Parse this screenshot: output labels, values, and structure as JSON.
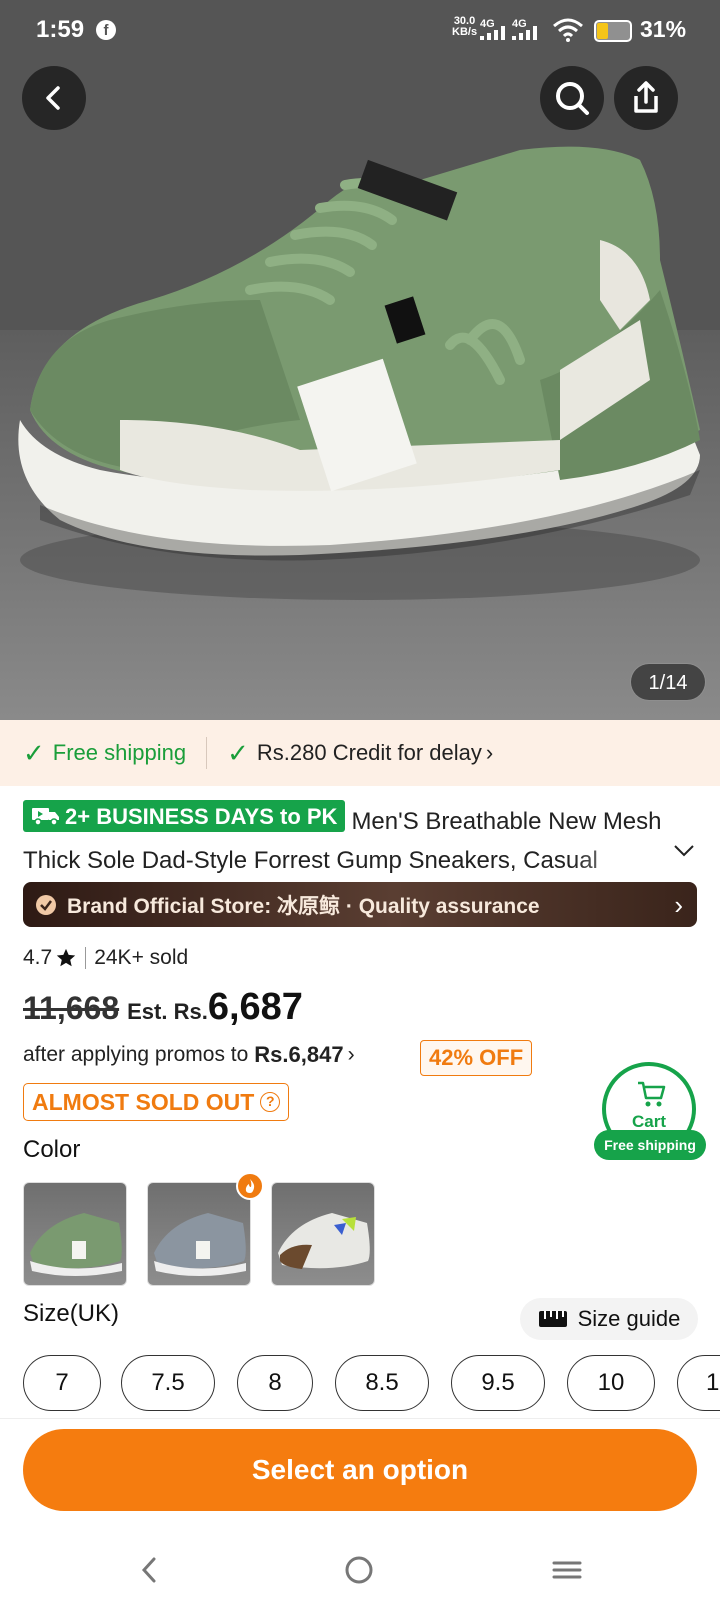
{
  "status_bar": {
    "time": "1:59",
    "network_speed": "30.0",
    "network_unit": "KB/s",
    "signal1": "4G",
    "signal2": "4G",
    "battery": "31%"
  },
  "hero": {
    "image_counter": "1/14",
    "icons": [
      "back-arrow-icon",
      "search-icon",
      "share-icon"
    ]
  },
  "shipping": {
    "free_shipping": "Free shipping",
    "credit": "Rs.280 Credit for delay"
  },
  "product": {
    "delivery_badge": "2+ BUSINESS DAYS to PK",
    "title": "Men'S Breathable New Mesh Thick Sole Dad-Style Forrest Gump Sneakers, Casual",
    "brand_store": "Brand Official Store: 冰原鲸 · Quality assurance",
    "rating": "4.7",
    "sold": "24K+ sold",
    "original_price": "11,668",
    "est_label": "Est. Rs.",
    "est_price": "6,687",
    "promo_text": "after applying promos to",
    "promo_price": "Rs.6,847",
    "discount": "42% OFF",
    "stock_warning": "ALMOST SOLD OUT"
  },
  "cart": {
    "label": "Cart",
    "free_shipping": "Free shipping"
  },
  "color": {
    "label": "Color",
    "swatches": [
      "green",
      "grey",
      "white-brown"
    ]
  },
  "size": {
    "label": "Size(UK)",
    "guide": "Size guide",
    "options": [
      "7",
      "7.5",
      "8",
      "8.5",
      "9.5",
      "10",
      "1"
    ]
  },
  "cta": {
    "label": "Select an option"
  },
  "colors": {
    "accent": "#f57c0f",
    "green": "#16a34a",
    "brand_bar": "#3a241b"
  }
}
